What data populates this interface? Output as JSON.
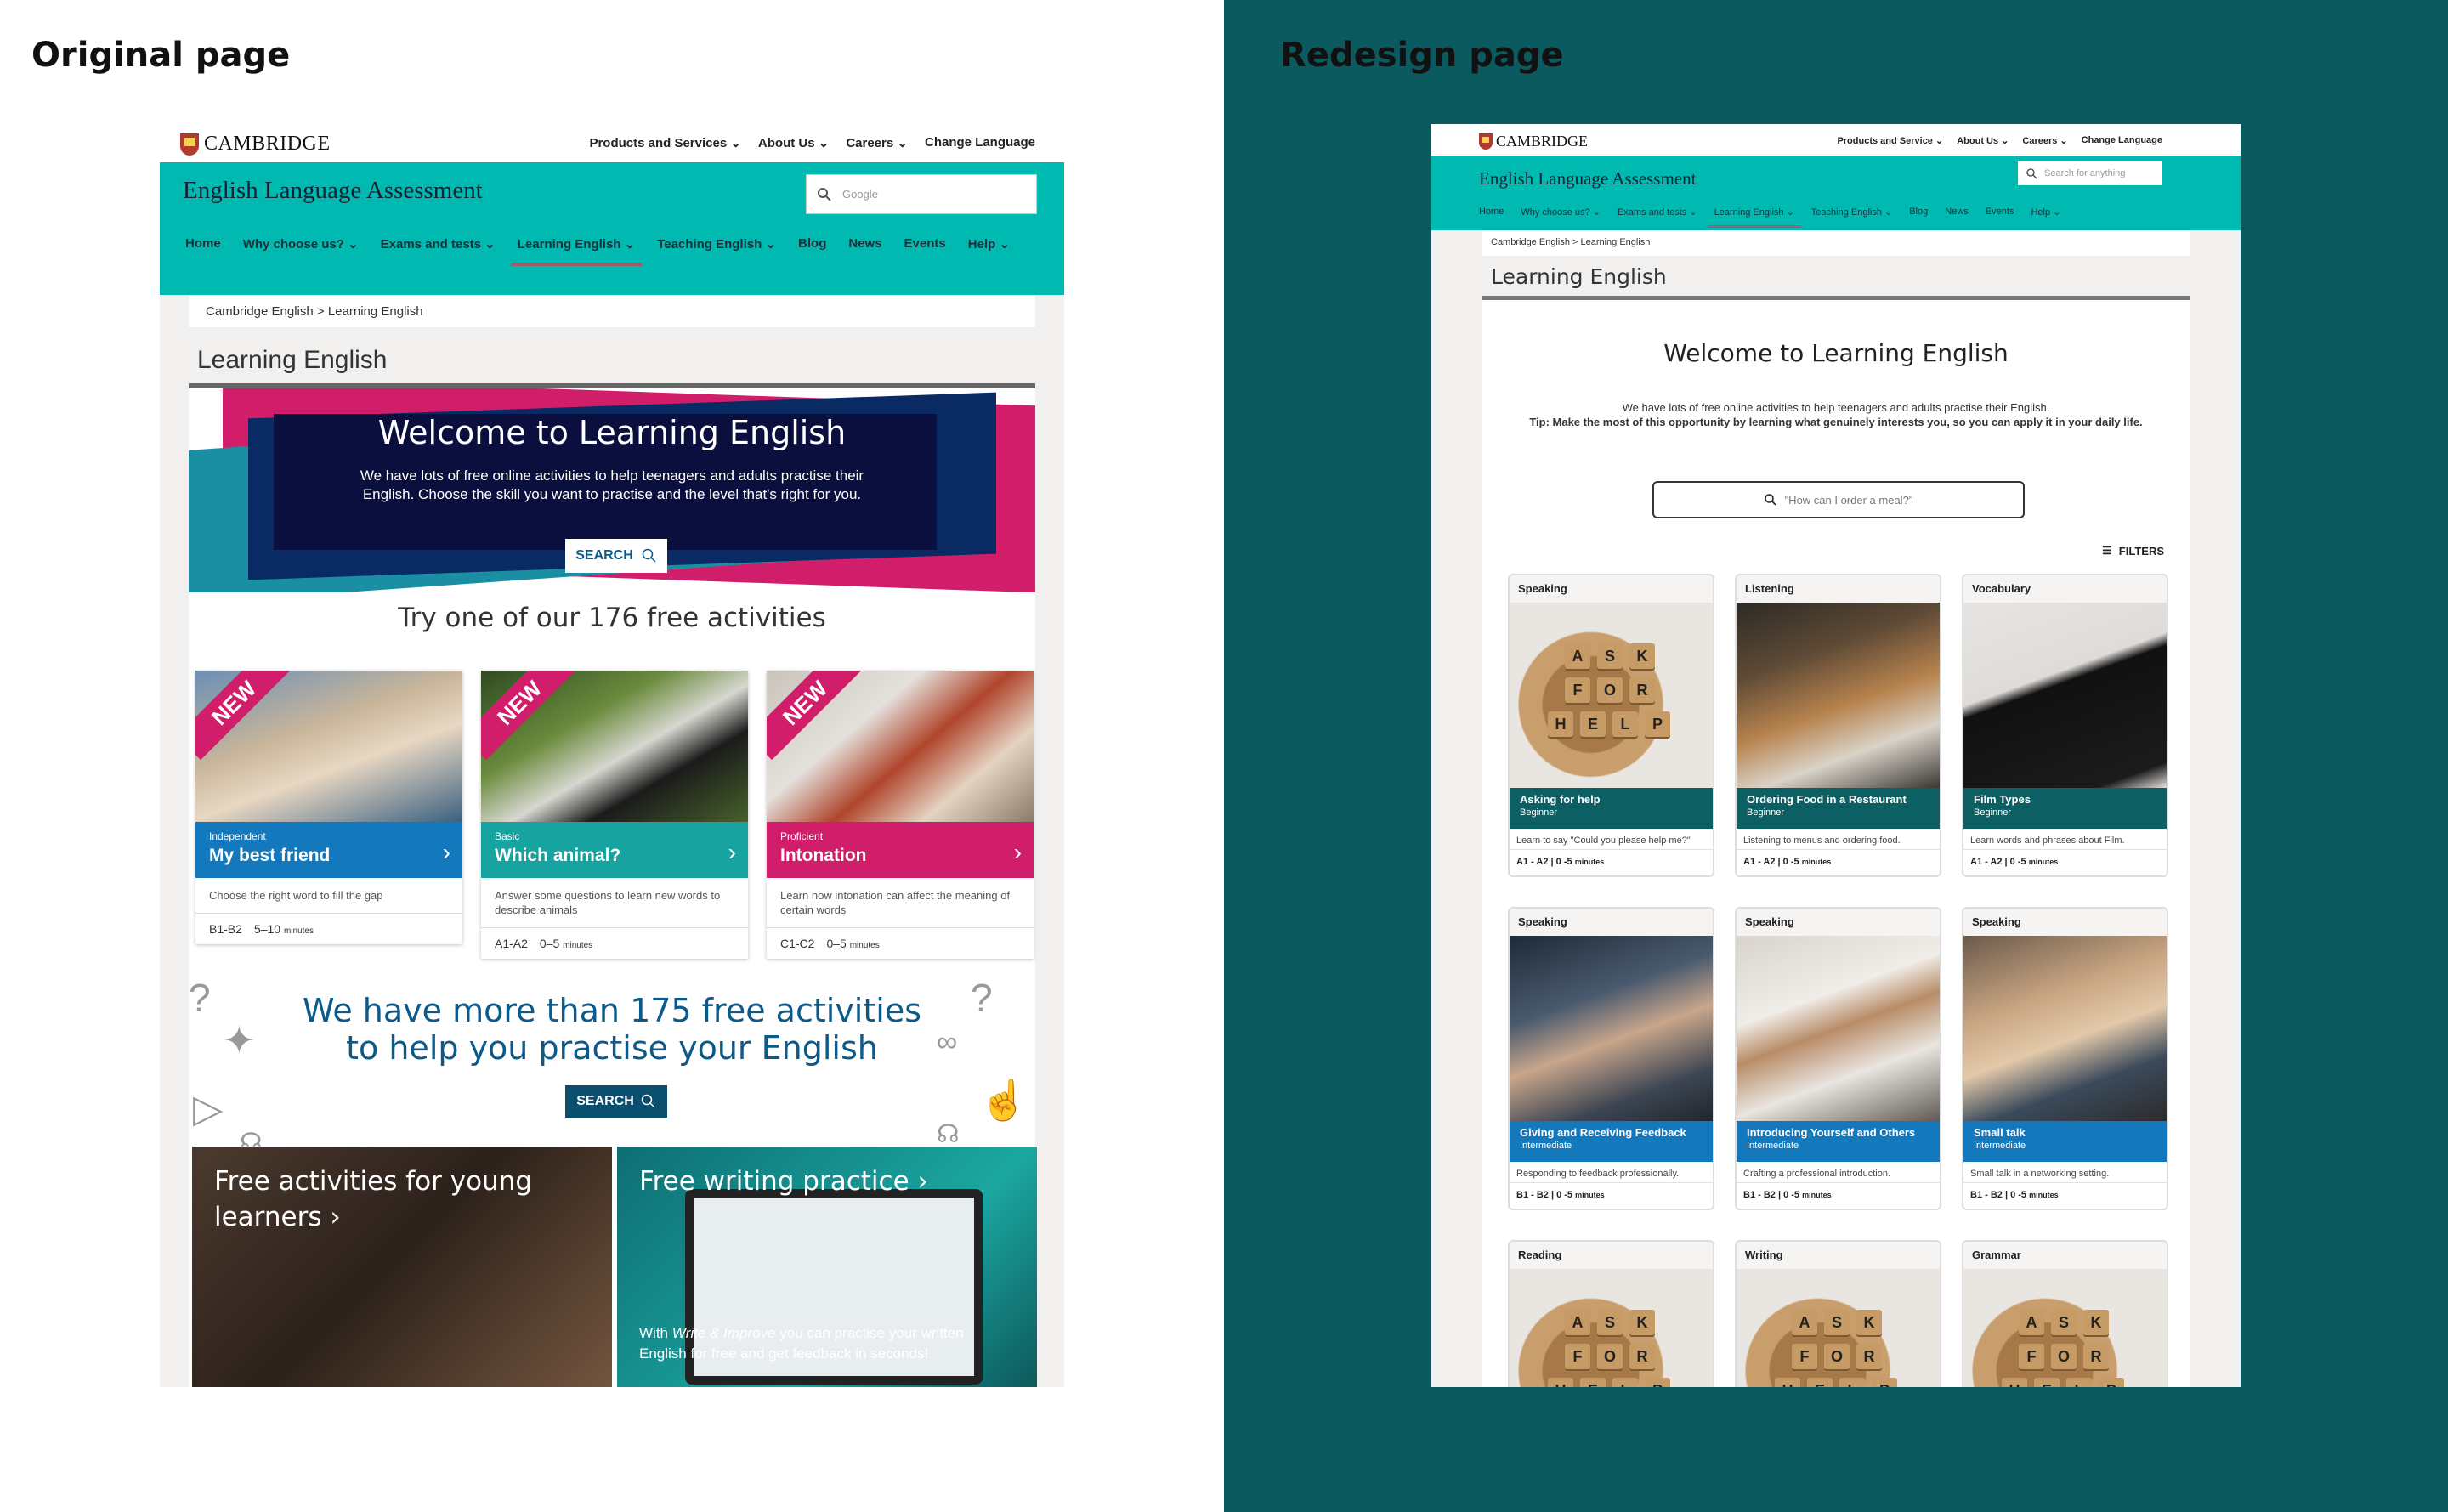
{
  "labels": {
    "original": "Original page",
    "redesign": "Redesign page"
  },
  "brand": {
    "logo": "CAMBRIDGE",
    "name": "English Language Assessment"
  },
  "original": {
    "topnav": [
      "Products and Services",
      "About Us",
      "Careers",
      "Change Language"
    ],
    "search_placeholder": "Google",
    "nav": [
      "Home",
      "Why choose us?",
      "Exams and tests",
      "Learning English",
      "Teaching English",
      "Blog",
      "News",
      "Events",
      "Help"
    ],
    "breadcrumb": "Cambridge English > Learning English",
    "page_title": "Learning English",
    "hero": {
      "title": "Welcome to Learning English",
      "subtitle": "We have lots of free online activities to help teenagers and adults practise their English. Choose the skill you want to practise and the level that's right for you.",
      "button": "SEARCH"
    },
    "try_heading": "Try one of our 176 free activities",
    "cards": [
      {
        "badge": "NEW",
        "level": "Independent",
        "title": "My best friend",
        "desc": "Choose the right word to fill the gap",
        "cefr": "B1-B2",
        "time": "5–10",
        "unit": "minutes",
        "color": "#1479bc"
      },
      {
        "badge": "NEW",
        "level": "Basic",
        "title": "Which animal?",
        "desc": "Answer some questions to learn new words to describe animals",
        "cefr": "A1-A2",
        "time": "0–5",
        "unit": "minutes",
        "color": "#17a3a0"
      },
      {
        "badge": "NEW",
        "level": "Proficient",
        "title": "Intonation",
        "desc": "Learn how intonation can affect the meaning of certain words",
        "cefr": "C1-C2",
        "time": "0–5",
        "unit": "minutes",
        "color": "#d11e6b"
      }
    ],
    "more_heading_1": "We have more than 175 free activities",
    "more_heading_2": "to help you practise your English",
    "more_button": "SEARCH",
    "promo_young_1": "Free activities for young",
    "promo_young_2": "learners",
    "promo_writing": "Free writing practice",
    "promo_writing_desc_1": "With ",
    "promo_writing_desc_em": "Write & Improve",
    "promo_writing_desc_2": " you can practise your written English for free and get feedback in seconds!"
  },
  "redesign": {
    "topnav": [
      "Products and Service",
      "About Us",
      "Careers",
      "Change Language"
    ],
    "search_placeholder": "Search for anything",
    "nav": [
      "Home",
      "Why choose us?",
      "Exams and tests",
      "Learning English",
      "Teaching English",
      "Blog",
      "News",
      "Events",
      "Help"
    ],
    "breadcrumb": "Cambridge English > Learning English",
    "page_title": "Learning English",
    "welcome": "Welcome to Learning English",
    "intro_1": "We have lots of free online activities to help teenagers and adults practise their English.",
    "intro_2": "Tip: Make the most of this opportunity by learning what genuinely interests you, so you can apply it in your daily life.",
    "search_placeholder_main": "\"How can I order a meal?\"",
    "filters": "FILTERS",
    "cards": [
      {
        "category": "Speaking",
        "title": "Asking for help",
        "level": "Beginner",
        "desc": "Learn to say \"Could you please help me?\"",
        "meta": "A1 - A2 | 0 -5",
        "unit": "minutes",
        "color": "#0c5f63",
        "photo": "ph-tiles"
      },
      {
        "category": "Listening",
        "title": "Ordering Food in a Restaurant",
        "level": "Beginner",
        "desc": "Listening to menus and ordering food.",
        "meta": "A1 - A2 | 0 -5",
        "unit": "minutes",
        "color": "#0c5f63",
        "photo": "ph-rest"
      },
      {
        "category": "Vocabulary",
        "title": "Film Types",
        "level": "Beginner",
        "desc": "Learn words and phrases about Film.",
        "meta": "A1 - A2 | 0 -5",
        "unit": "minutes",
        "color": "#0c5f63",
        "photo": "ph-tv"
      },
      {
        "category": "Speaking",
        "title": "Giving and Receiving Feedback",
        "level": "Intermediate",
        "desc": "Responding to feedback professionally.",
        "meta": "B1 - B2 | 0 -5",
        "unit": "minutes",
        "color": "#1479bc",
        "photo": "ph-meet"
      },
      {
        "category": "Speaking",
        "title": "Introducing Yourself and Others",
        "level": "Intermediate",
        "desc": "Crafting a professional introduction.",
        "meta": "B1 - B2 | 0 -5",
        "unit": "minutes",
        "color": "#1479bc",
        "photo": "ph-shelf"
      },
      {
        "category": "Speaking",
        "title": "Small talk",
        "level": "Intermediate",
        "desc": "Small talk in a networking setting.",
        "meta": "B1 - B2 | 0 -5",
        "unit": "minutes",
        "color": "#1479bc",
        "photo": "ph-talk"
      },
      {
        "category": "Reading",
        "title": "",
        "level": "",
        "desc": "",
        "meta": "",
        "unit": "",
        "color": "#0c5f63",
        "photo": "ph-tiles"
      },
      {
        "category": "Writing",
        "title": "",
        "level": "",
        "desc": "",
        "meta": "",
        "unit": "",
        "color": "#0c5f63",
        "photo": "ph-tiles"
      },
      {
        "category": "Grammar",
        "title": "",
        "level": "",
        "desc": "",
        "meta": "",
        "unit": "",
        "color": "#0c5f63",
        "photo": "ph-tiles"
      }
    ],
    "tiles_text": [
      "A",
      "S",
      "K",
      "F",
      "O",
      "R",
      "H",
      "E",
      "L",
      "P"
    ]
  },
  "colors": {
    "teal_band": "#00b9b1",
    "right_background": "#0b5a5f",
    "accent_pink": "#d11e6b",
    "accent_blue": "#1479bc"
  }
}
